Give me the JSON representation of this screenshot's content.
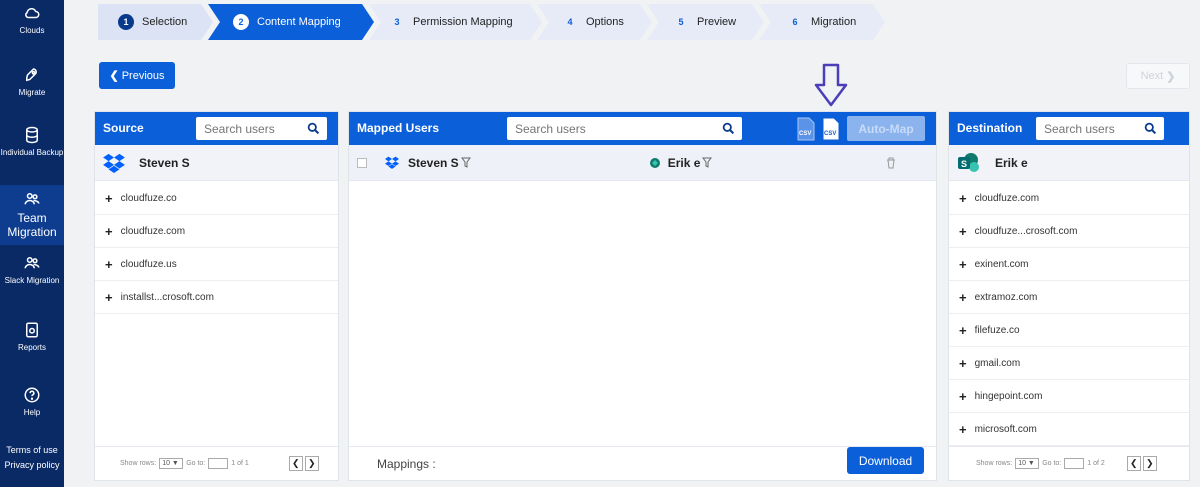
{
  "sidebar": {
    "items": [
      {
        "label": "Clouds",
        "icon": "cloud-icon"
      },
      {
        "label": "Migrate",
        "icon": "rocket-icon"
      },
      {
        "label": "Individual Backup",
        "icon": "database-icon"
      },
      {
        "label": "Team Migration",
        "icon": "team-icon",
        "active": true
      },
      {
        "label": "Slack Migration",
        "icon": "team-icon"
      },
      {
        "label": "Reports",
        "icon": "report-icon"
      },
      {
        "label": "Help",
        "icon": "help-icon"
      }
    ],
    "footer": [
      "Terms of use",
      "Privacy policy"
    ]
  },
  "steps": [
    {
      "num": "1",
      "label": "Selection",
      "state": "done"
    },
    {
      "num": "2",
      "label": "Content Mapping",
      "state": "active"
    },
    {
      "num": "3",
      "label": "Permission Mapping",
      "state": "todo"
    },
    {
      "num": "4",
      "label": "Options",
      "state": "todo"
    },
    {
      "num": "5",
      "label": "Preview",
      "state": "todo"
    },
    {
      "num": "6",
      "label": "Migration",
      "state": "todo"
    }
  ],
  "nav": {
    "previous": "Previous",
    "next": "Next"
  },
  "source": {
    "title": "Source",
    "search_placeholder": "Search users",
    "user": "Steven S",
    "items": [
      "cloudfuze.co",
      "cloudfuze.com",
      "cloudfuze.us",
      "installst...crosoft.com"
    ],
    "pager": {
      "show_rows": "Show rows:",
      "rows": "10",
      "goto": "Go to:",
      "page_text": "1 of 1"
    }
  },
  "mapped": {
    "title": "Mapped Users",
    "search_placeholder": "Search users",
    "automap": "Auto-Map",
    "row": {
      "source_user": "Steven S",
      "dest_user": "Erik e"
    },
    "mappings_label": "Mappings :",
    "download": "Download"
  },
  "destination": {
    "title": "Destination",
    "search_placeholder": "Search users",
    "user": "Erik e",
    "items": [
      "cloudfuze.com",
      "cloudfuze...crosoft.com",
      "exinent.com",
      "extramoz.com",
      "filefuze.co",
      "gmail.com",
      "hingepoint.com",
      "microsoft.com"
    ],
    "pager": {
      "show_rows": "Show rows:",
      "rows": "10",
      "goto": "Go to:",
      "page_text": "1 of 2"
    }
  },
  "colors": {
    "primary": "#0b5fd8",
    "sidebar": "#0a2a66",
    "arrow": "#4a3fb8"
  }
}
